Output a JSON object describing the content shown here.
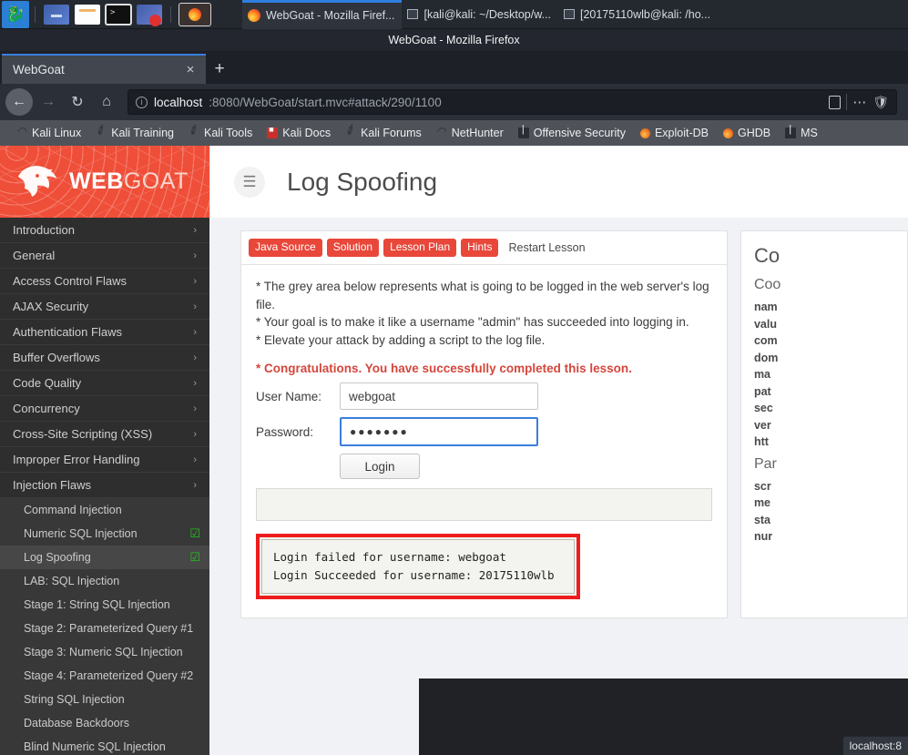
{
  "taskbar": {
    "launcher_icons": [
      "kali-dragon-icon",
      "files-icon",
      "folder-icon",
      "terminal-icon",
      "screen-recorder-icon",
      "firefox-icon"
    ],
    "windows": [
      {
        "label": "WebGoat - Mozilla Firef...",
        "icon": "firefox-icon",
        "selected": true
      },
      {
        "label": "[kali@kali: ~/Desktop/w...",
        "icon": "window-icon",
        "selected": false
      },
      {
        "label": "[20175110wlb@kali: /ho...",
        "icon": "window-icon",
        "selected": false
      }
    ]
  },
  "browser": {
    "window_title": "WebGoat - Mozilla Firefox",
    "tab": {
      "title": "WebGoat",
      "close_label": "×"
    },
    "new_tab_label": "+",
    "nav": {
      "back": "←",
      "forward": "→",
      "reload": "↻",
      "home": "⌂"
    },
    "url": {
      "host": "localhost",
      "path": ":8080/WebGoat/start.mvc#attack/290/1100"
    },
    "url_icons": [
      "info-icon",
      "reader-mode-icon",
      "page-actions-icon",
      "tracking-shield-icon"
    ],
    "bookmarks": [
      {
        "label": "Kali Linux",
        "icon": "kali-dragon-icon"
      },
      {
        "label": "Kali Training",
        "icon": "wrench-icon"
      },
      {
        "label": "Kali Tools",
        "icon": "wrench-icon"
      },
      {
        "label": "Kali Docs",
        "icon": "docs-icon"
      },
      {
        "label": "Kali Forums",
        "icon": "wrench-icon"
      },
      {
        "label": "NetHunter",
        "icon": "kali-dragon-icon"
      },
      {
        "label": "Offensive Security",
        "icon": "offsec-icon"
      },
      {
        "label": "Exploit-DB",
        "icon": "flame-icon"
      },
      {
        "label": "GHDB",
        "icon": "flame-icon"
      },
      {
        "label": "MS",
        "icon": "offsec-icon"
      }
    ],
    "status_bubble": "localhost:8"
  },
  "webgoat": {
    "brand": {
      "word1": "WEB",
      "word2": "GOAT",
      "logo": "goat-head-icon"
    },
    "page_title": "Log Spoofing",
    "menu_icon": "hamburger-icon",
    "sidebar": [
      {
        "type": "category",
        "label": "Introduction"
      },
      {
        "type": "category",
        "label": "General"
      },
      {
        "type": "category",
        "label": "Access Control Flaws"
      },
      {
        "type": "category",
        "label": "AJAX Security"
      },
      {
        "type": "category",
        "label": "Authentication Flaws"
      },
      {
        "type": "category",
        "label": "Buffer Overflows"
      },
      {
        "type": "category",
        "label": "Code Quality"
      },
      {
        "type": "category",
        "label": "Concurrency"
      },
      {
        "type": "category",
        "label": "Cross-Site Scripting (XSS)"
      },
      {
        "type": "category",
        "label": "Improper Error Handling"
      },
      {
        "type": "category",
        "label": "Injection Flaws",
        "expanded": true
      },
      {
        "type": "lesson",
        "label": "Command Injection",
        "complete": false
      },
      {
        "type": "lesson",
        "label": "Numeric SQL Injection",
        "complete": true
      },
      {
        "type": "lesson",
        "label": "Log Spoofing",
        "complete": true,
        "selected": true
      },
      {
        "type": "lesson",
        "label": "LAB: SQL Injection",
        "complete": false
      },
      {
        "type": "lesson",
        "label": "Stage 1: String SQL Injection",
        "complete": false
      },
      {
        "type": "lesson",
        "label": "Stage 2: Parameterized Query #1",
        "complete": false
      },
      {
        "type": "lesson",
        "label": "Stage 3: Numeric SQL Injection",
        "complete": false
      },
      {
        "type": "lesson",
        "label": "Stage 4: Parameterized Query #2",
        "complete": false
      },
      {
        "type": "lesson",
        "label": "String SQL Injection",
        "complete": false
      },
      {
        "type": "lesson",
        "label": "Database Backdoors",
        "complete": false
      },
      {
        "type": "lesson",
        "label": "Blind Numeric SQL Injection",
        "complete": false
      }
    ],
    "lesson_tabs": [
      {
        "label": "Java Source",
        "style": "pill"
      },
      {
        "label": "Solution",
        "style": "pill"
      },
      {
        "label": "Lesson Plan",
        "style": "pill"
      },
      {
        "label": "Hints",
        "style": "pill"
      },
      {
        "label": "Restart Lesson",
        "style": "plain"
      }
    ],
    "instructions": [
      "* The grey area below represents what is going to be logged in the web server's log file.",
      "* Your goal is to make it like a username \"admin\" has succeeded into logging in.",
      "* Elevate your attack by adding a script to the log file."
    ],
    "congratulations": "* Congratulations. You have successfully completed this lesson.",
    "form": {
      "username_label": "User Name:",
      "username_value": "webgoat",
      "password_label": "Password:",
      "password_value": "●●●●●●●",
      "login_button": "Login"
    },
    "log_output": [
      "Login failed for username: webgoat",
      "Login Succeeded for username: 20175110wlb"
    ],
    "right_panel": {
      "title": "Co",
      "cookies_heading": "Coo",
      "cookie_fields": [
        "nam",
        "valu",
        "com",
        "dom",
        "ma",
        "pat",
        "sec",
        "ver",
        "htt"
      ],
      "params_heading": "Par",
      "param_fields": [
        "scr",
        "me",
        "sta",
        "nur"
      ]
    }
  },
  "colors": {
    "brand_red": "#ef4e38",
    "pill_red": "#e8473a",
    "alert_border": "#ee1c1c",
    "check_green": "#1fc41f",
    "focus_blue": "#3b7ddd"
  }
}
